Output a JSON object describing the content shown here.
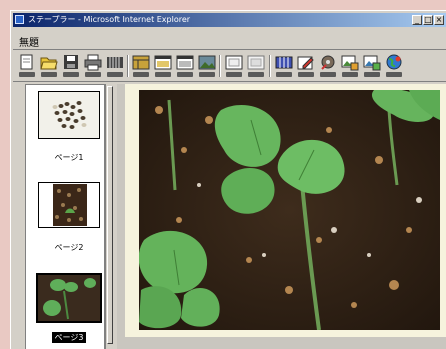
{
  "window": {
    "title": "ステープラー - Microsoft Internet Explorer"
  },
  "window_buttons": [
    "_",
    "□",
    "×"
  ],
  "tab": {
    "label": "無題"
  },
  "toolbar": {
    "items": [
      {
        "icon": "new-page-icon"
      },
      {
        "icon": "open-folder-icon"
      },
      {
        "icon": "save-icon"
      },
      {
        "icon": "print-icon"
      },
      {
        "icon": "stack-icon"
      },
      {
        "icon": "layout-icon"
      },
      {
        "icon": "window-icon"
      },
      {
        "icon": "image-window-icon"
      },
      {
        "icon": "frame-icon"
      },
      {
        "icon": "frame-empty-icon"
      },
      {
        "icon": "grid-icon"
      },
      {
        "icon": "edit-icon"
      },
      {
        "icon": "tools-icon"
      },
      {
        "icon": "insert-image-icon"
      },
      {
        "icon": "export-image-icon"
      },
      {
        "icon": "globe-icon"
      }
    ]
  },
  "pages": [
    {
      "label": "ページ1",
      "selected": false,
      "subject": "seeds"
    },
    {
      "label": "ページ2",
      "selected": false,
      "subject": "seed-jar"
    },
    {
      "label": "ページ3",
      "selected": true,
      "subject": "seedling"
    }
  ],
  "scroll_arrows": {
    "down": "▼",
    "left": "◄"
  },
  "colors": {
    "titlebar_start": "#0a246a",
    "titlebar_end": "#a6caf0",
    "chrome": "#d4d0c8",
    "canvas": "#f6f3dd",
    "desktop": "#e9c9c3"
  }
}
